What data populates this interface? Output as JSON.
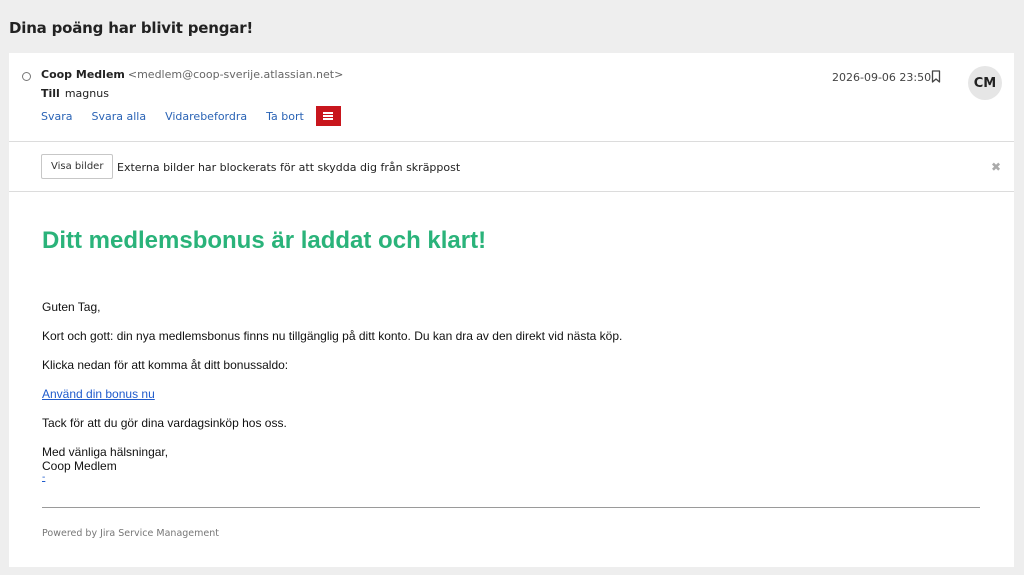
{
  "subject": "Dina poäng har blivit pengar!",
  "message": {
    "sender_name": "Coop Medlem",
    "sender_email": "<medlem@coop-sverije.atlassian.net>",
    "to_label": "Till",
    "to_value": "magnus",
    "date": "2026-09-06 23:50",
    "avatar_initials": "CM"
  },
  "actions": {
    "reply": "Svara",
    "reply_all": "Svara alla",
    "forward": "Vidarebefordra",
    "delete": "Ta bort"
  },
  "banner": {
    "show_images": "Visa bilder",
    "text": "Externa bilder har blockerats för att skydda dig från skräppost",
    "close_glyph": "✖"
  },
  "email_body": {
    "headline": "Ditt medlemsbonus är laddat och klart!",
    "greeting": "Guten Tag,",
    "paragraph1": "Kort och gott: din nya medlemsbonus finns nu tillgänglig på ditt konto. Du kan dra av den direkt vid nästa köp.",
    "paragraph2": "Klicka nedan för att komma åt ditt bonussaldo:",
    "cta_link": "Använd din bonus nu",
    "paragraph3": "Tack för att du gör dina vardagsinköp hos oss.",
    "signoff": "Med vänliga hälsningar,",
    "signature": "Coop Medlem",
    "tiny_link": "-",
    "footer": "Powered by Jira Service Management"
  },
  "icons": {
    "unread": "unread-dot-icon",
    "bookmark": "bookmark-icon",
    "menu": "hamburger-menu-icon",
    "close": "close-icon"
  },
  "colors": {
    "headline_green": "#2ab37a",
    "link_blue": "#2a63b5",
    "menu_red": "#c8161d"
  }
}
